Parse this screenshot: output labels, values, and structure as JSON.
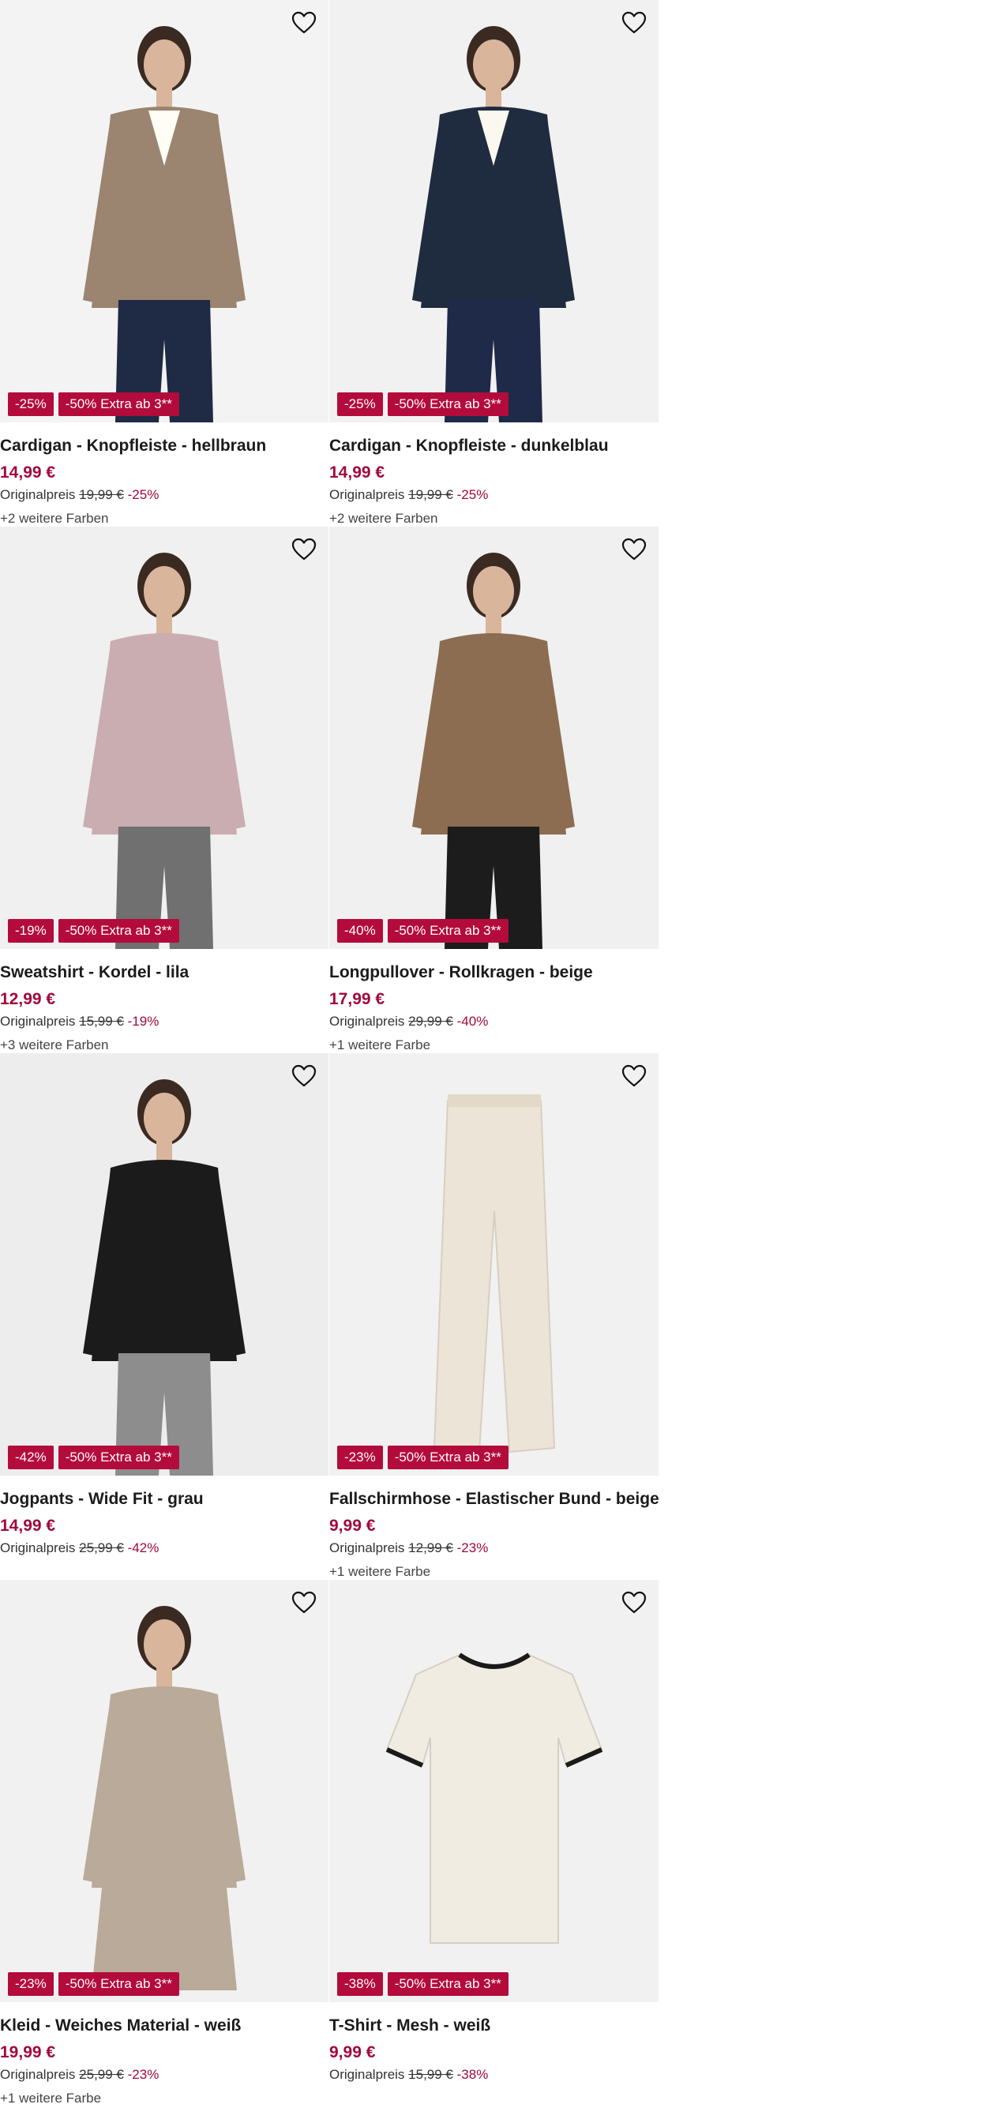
{
  "products": [
    {
      "title": "Cardigan - Knopfleiste - hellbraun",
      "price": "14,99 €",
      "orig_label": "Originalpreis",
      "orig_price": "19,99 €",
      "discount": "-25%",
      "badge_discount": "-25%",
      "badge_promo": "-50% Extra ab 3**",
      "colors": "+2 weitere Farben",
      "bg": "#f3f3f3",
      "garment": "#9b8470",
      "accent": "#fffdf5",
      "bottom": "#1f2a45"
    },
    {
      "title": "Cardigan - Knopfleiste - dunkelblau",
      "price": "14,99 €",
      "orig_label": "Originalpreis",
      "orig_price": "19,99 €",
      "discount": "-25%",
      "badge_discount": "-25%",
      "badge_promo": "-50% Extra ab 3**",
      "colors": "+2 weitere Farben",
      "bg": "#f1f1f1",
      "garment": "#1f2b3f",
      "accent": "#fbf8ef",
      "bottom": "#1e2a48"
    },
    {
      "title": "Sweatshirt - Kordel - lila",
      "price": "12,99 €",
      "orig_label": "Originalpreis",
      "orig_price": "15,99 €",
      "discount": "-19%",
      "badge_discount": "-19%",
      "badge_promo": "-50% Extra ab 3**",
      "colors": "+3 weitere Farben",
      "bg": "#f0f0f0",
      "garment": "#c9adb1",
      "accent": "#c9adb1",
      "bottom": "#707070"
    },
    {
      "title": "Longpullover - Rollkragen - beige",
      "price": "17,99 €",
      "orig_label": "Originalpreis",
      "orig_price": "29,99 €",
      "discount": "-40%",
      "badge_discount": "-40%",
      "badge_promo": "-50% Extra ab 3**",
      "colors": "+1 weitere Farbe",
      "bg": "#f0f0f0",
      "garment": "#8c6d52",
      "accent": "#8c6d52",
      "bottom": "#1c1c1c"
    },
    {
      "title": "Jogpants - Wide Fit - grau",
      "price": "14,99 €",
      "orig_label": "Originalpreis",
      "orig_price": "25,99 €",
      "discount": "-42%",
      "badge_discount": "-42%",
      "badge_promo": "-50% Extra ab 3**",
      "colors": "",
      "bg": "#ededed",
      "garment": "#1b1b1b",
      "accent": "#1b1b1b",
      "bottom": "#8d8d8d"
    },
    {
      "title": "Fallschirmhose - Elastischer Bund - beige",
      "price": "9,99 €",
      "orig_label": "Originalpreis",
      "orig_price": "12,99 €",
      "discount": "-23%",
      "badge_discount": "-23%",
      "badge_promo": "-50% Extra ab 3**",
      "colors": "+1 weitere Farbe",
      "bg": "#f1f1f1",
      "garment": "#ece4d6",
      "accent": "#ece4d6",
      "bottom": "#e6ddcd"
    },
    {
      "title": "Kleid - Weiches Material - weiß",
      "price": "19,99 €",
      "orig_label": "Originalpreis",
      "orig_price": "25,99 €",
      "discount": "-23%",
      "badge_discount": "-23%",
      "badge_promo": "-50% Extra ab 3**",
      "colors": "+1 weitere Farbe",
      "bg": "#f1f1f1",
      "garment": "#b9aa99",
      "accent": "#b9aa99",
      "bottom": "#b9aa99"
    },
    {
      "title": "T-Shirt - Mesh - weiß",
      "price": "9,99 €",
      "orig_label": "Originalpreis",
      "orig_price": "15,99 €",
      "discount": "-38%",
      "badge_discount": "-38%",
      "badge_promo": "-50% Extra ab 3**",
      "colors": "",
      "bg": "#f1f1f1",
      "garment": "#f1ece1",
      "accent": "#1a1a1a",
      "bottom": "#f1ece1"
    }
  ],
  "icons": {
    "favorite": "heart-outline-icon"
  },
  "colors": {
    "sale": "#a1093b",
    "badge": "#b30b3c"
  }
}
